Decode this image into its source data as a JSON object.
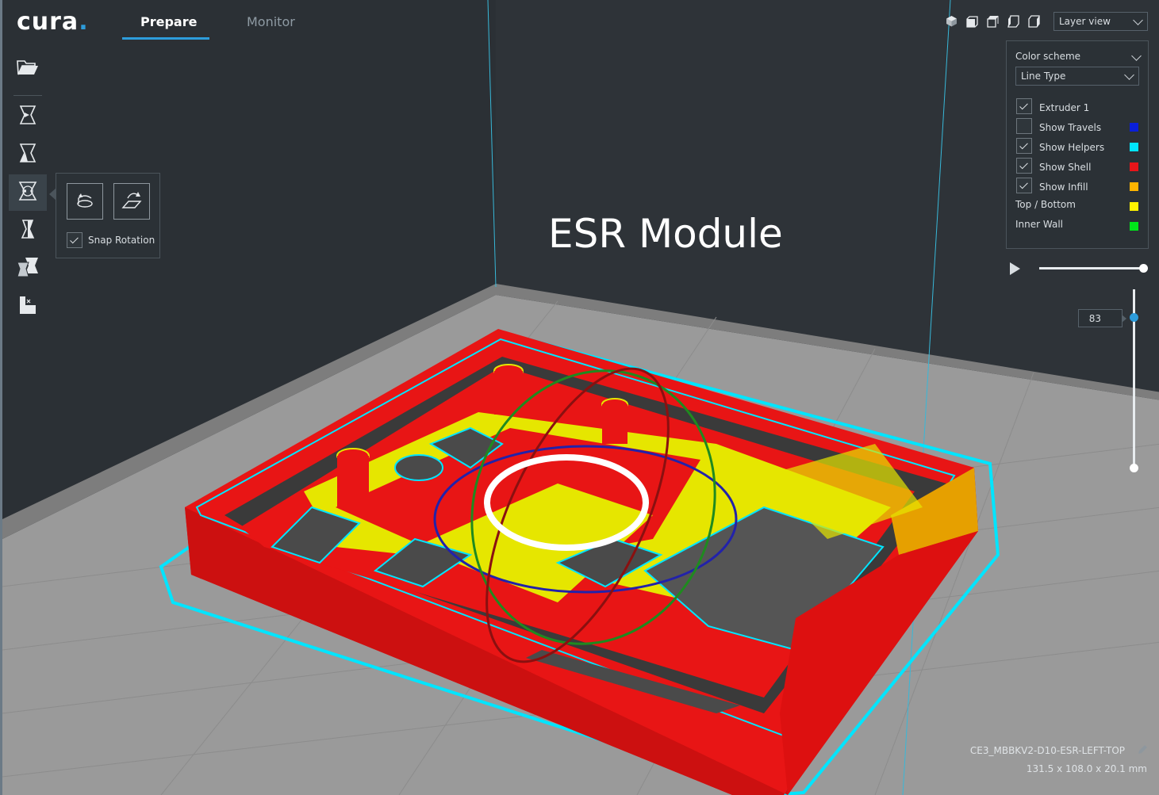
{
  "app": {
    "logo_text": "cura",
    "logo_dot": "."
  },
  "tabs": [
    {
      "label": "Prepare",
      "active": true
    },
    {
      "label": "Monitor",
      "active": false
    }
  ],
  "view": {
    "select_value": "Layer view",
    "icons": [
      "3d-view-icon",
      "front-view-icon",
      "top-view-icon",
      "left-view-icon",
      "right-view-icon"
    ]
  },
  "toolbar": {
    "items": [
      "open-file-icon",
      "move-tool-icon",
      "scale-tool-icon",
      "rotate-tool-icon",
      "mirror-tool-icon",
      "per-model-settings-icon",
      "support-blocker-icon"
    ],
    "active": "rotate-tool-icon"
  },
  "rotate_panel": {
    "buttons": [
      "reset-rotation-icon",
      "lay-flat-icon"
    ],
    "snap_label": "Snap Rotation",
    "snap_checked": true
  },
  "color_panel": {
    "title": "Color scheme",
    "scheme_value": "Line Type",
    "items": [
      {
        "label": "Extruder 1",
        "checked": true,
        "color": null
      },
      {
        "label": "Show Travels",
        "checked": false,
        "color": "#0a1fd9"
      },
      {
        "label": "Show Helpers",
        "checked": true,
        "color": "#00e5ff"
      },
      {
        "label": "Show Shell",
        "checked": true,
        "color": "#e8151a"
      },
      {
        "label": "Show Infill",
        "checked": true,
        "color": "#ffb400"
      },
      {
        "label": "Top / Bottom",
        "checked": null,
        "color": "#fff200"
      },
      {
        "label": "Inner Wall",
        "checked": null,
        "color": "#00e51a"
      }
    ]
  },
  "layer": {
    "current": "83"
  },
  "overlay_title": "ESR Module",
  "object": {
    "name": "CE3_MBBKV2-D10-ESR-LEFT-TOP",
    "dimensions": "131.5 x 108.0 x 20.1 mm"
  }
}
